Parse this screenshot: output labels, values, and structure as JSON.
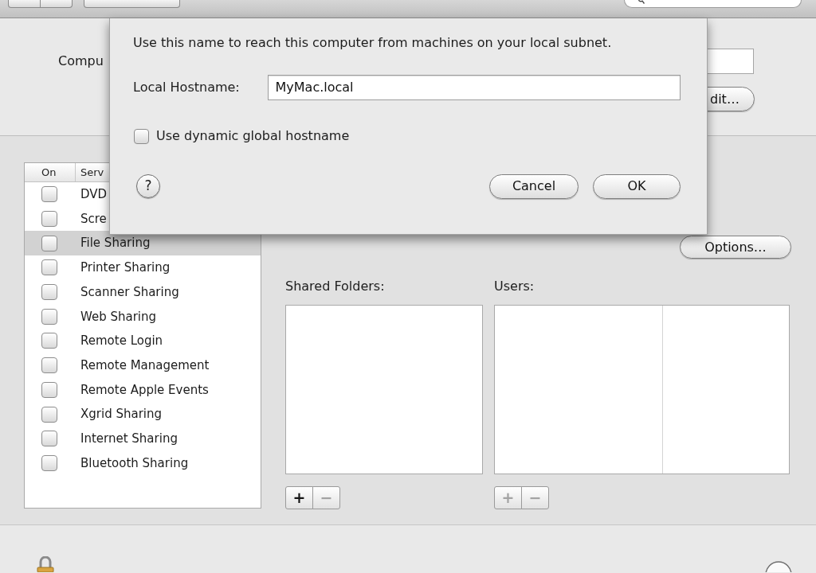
{
  "computer_name": {
    "label": "Compu"
  },
  "edit_button": {
    "label": "dit…"
  },
  "services": {
    "columns": [
      "On",
      "Serv"
    ],
    "rows": [
      {
        "name": "DVD",
        "on": false,
        "selected": false
      },
      {
        "name": "Scre",
        "on": false,
        "selected": false
      },
      {
        "name": "File Sharing",
        "on": false,
        "selected": true
      },
      {
        "name": "Printer Sharing",
        "on": false,
        "selected": false
      },
      {
        "name": "Scanner Sharing",
        "on": false,
        "selected": false
      },
      {
        "name": "Web Sharing",
        "on": false,
        "selected": false
      },
      {
        "name": "Remote Login",
        "on": false,
        "selected": false
      },
      {
        "name": "Remote Management",
        "on": false,
        "selected": false
      },
      {
        "name": "Remote Apple Events",
        "on": false,
        "selected": false
      },
      {
        "name": "Xgrid Sharing",
        "on": false,
        "selected": false
      },
      {
        "name": "Internet Sharing",
        "on": false,
        "selected": false
      },
      {
        "name": "Bluetooth Sharing",
        "on": false,
        "selected": false
      }
    ]
  },
  "options_button": {
    "label": "Options…"
  },
  "shared_folders": {
    "label": "Shared Folders:",
    "buttons": [
      {
        "label": "+",
        "disabled": false
      },
      {
        "label": "−",
        "disabled": true
      }
    ]
  },
  "users": {
    "label": "Users:",
    "buttons": [
      {
        "label": "+",
        "disabled": true
      },
      {
        "label": "−",
        "disabled": true
      }
    ]
  },
  "sheet": {
    "message": "Use this name to reach this computer from machines on your local subnet.",
    "hostname": {
      "label": "Local Hostname:",
      "value": "MyMac.local"
    },
    "dynamic_hostname": {
      "label": "Use dynamic global hostname",
      "checked": false
    },
    "help_button": {
      "label": "?"
    },
    "buttons": [
      {
        "label": "Cancel"
      },
      {
        "label": "OK"
      }
    ]
  }
}
